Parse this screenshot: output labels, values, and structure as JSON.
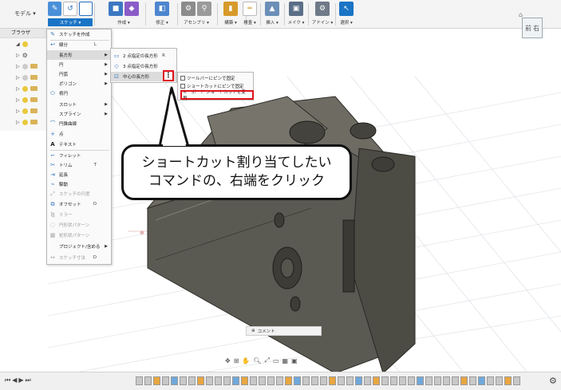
{
  "toolbar": {
    "mode_label": "モデル ▾",
    "groups": [
      {
        "label": "スケッチ ▾",
        "active": true
      },
      {
        "label": "作成 ▾"
      },
      {
        "label": "修正 ▾"
      },
      {
        "label": "アセンブリ ▾"
      },
      {
        "label": "構築 ▾"
      },
      {
        "label": "検査 ▾"
      },
      {
        "label": "挿入 ▾"
      },
      {
        "label": "メイク ▾"
      },
      {
        "label": "アドイン ▾"
      },
      {
        "label": "選択 ▾"
      }
    ]
  },
  "viewcube": {
    "face": "前",
    "side": "右"
  },
  "browser": {
    "title": "ブラウザ"
  },
  "sketch_menu": {
    "items": [
      {
        "label": "スケッチを作成",
        "key": ""
      },
      {
        "label": "線分",
        "key": "L"
      },
      {
        "label": "長方形",
        "key": "",
        "submenu": true
      },
      {
        "label": "円",
        "key": "",
        "submenu": true
      },
      {
        "label": "円弧",
        "key": "",
        "submenu": true
      },
      {
        "label": "ポリゴン",
        "key": "",
        "submenu": true
      },
      {
        "label": "楕円",
        "key": ""
      },
      {
        "label": "スロット",
        "key": "",
        "submenu": true
      },
      {
        "label": "スプライン",
        "key": "",
        "submenu": true
      },
      {
        "label": "円錐曲線",
        "key": ""
      },
      {
        "label": "点",
        "key": ""
      },
      {
        "label": "テキスト",
        "key": ""
      },
      {
        "label": "フィレット",
        "key": ""
      },
      {
        "label": "トリム",
        "key": "T"
      },
      {
        "label": "延長",
        "key": ""
      },
      {
        "label": "駆動",
        "key": ""
      },
      {
        "label": "スケッチの尺度",
        "key": ""
      },
      {
        "label": "オフセット",
        "key": "O"
      },
      {
        "label": "ミラー",
        "key": ""
      },
      {
        "label": "円形状パターン",
        "key": ""
      },
      {
        "label": "矩形状パターン",
        "key": ""
      },
      {
        "label": "プロジェクト/含める",
        "key": "",
        "submenu": true
      },
      {
        "label": "スケッチ寸法",
        "key": "D"
      }
    ]
  },
  "rect_submenu": {
    "items": [
      {
        "label": "2 点指定の長方形",
        "key": "R"
      },
      {
        "label": "3 点指定の長方形",
        "key": ""
      },
      {
        "label": "中心の長方形",
        "key": ""
      }
    ],
    "more_button": "⋮"
  },
  "pin_menu": {
    "items": [
      "ツールバーにピンで固定",
      "ショートカットにピンで固定",
      "キーボード ショートカットを変更..."
    ]
  },
  "callout": {
    "line1": "ショートカット割り当てしたい",
    "line2": "コマンドの、右端をクリック"
  },
  "comment_bar": {
    "label": "コメント"
  },
  "colors": {
    "accent": "#1a74c5",
    "highlight": "#e0121b",
    "camera": "#5b5a52"
  }
}
